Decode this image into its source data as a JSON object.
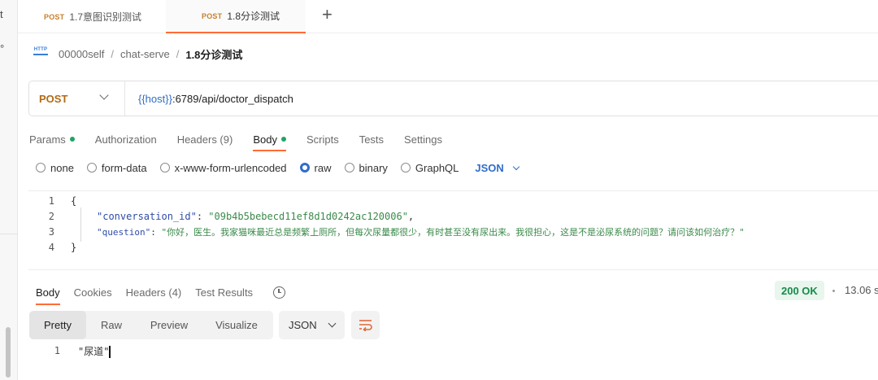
{
  "left_strip": {
    "char_top": "t",
    "char_mid": "°"
  },
  "tabs": [
    {
      "method": "POST",
      "name": "1.7意图识别测试"
    },
    {
      "method": "POST",
      "name": "1.8分诊测试"
    }
  ],
  "new_tab_glyph": "+",
  "breadcrumb": {
    "icon_label": "HTTP",
    "items": [
      "00000self",
      "chat-serve",
      "1.8分诊测试"
    ],
    "separator": "/"
  },
  "request": {
    "method": "POST",
    "url_var": "{{host}}",
    "url_rest": ":6789/api/doctor_dispatch"
  },
  "request_tabs": [
    "Params",
    "Authorization",
    "Headers (9)",
    "Body",
    "Scripts",
    "Tests",
    "Settings"
  ],
  "body_types": [
    "none",
    "form-data",
    "x-www-form-urlencoded",
    "raw",
    "binary",
    "GraphQL"
  ],
  "body_format": "JSON",
  "editor": {
    "line_numbers": [
      "1",
      "2",
      "3",
      "4"
    ],
    "open_brace": "{",
    "close_brace": "}",
    "key1": "\"conversation_id\"",
    "val1": "\"09b4b5bebecd11ef8d1d0242ac120006\"",
    "key2": "\"question\"",
    "val2": "\"你好，医生。我家猫咪最近总是频繁上厕所，但每次尿量都很少，有时甚至没有尿出来。我很担心，这是不是泌尿系统的问题？请问该如何治疗？\""
  },
  "response_tabs": [
    "Body",
    "Cookies",
    "Headers (4)",
    "Test Results"
  ],
  "response": {
    "status": "200 OK",
    "time": "13.06 s",
    "view_modes": [
      "Pretty",
      "Raw",
      "Preview",
      "Visualize"
    ],
    "format": "JSON",
    "line_number": "1",
    "body": "\"尿道\""
  },
  "colors": {
    "accent": "#ff6c37",
    "post": "#b26a14",
    "link": "#2f6dc8",
    "ok": "#168a4a"
  }
}
